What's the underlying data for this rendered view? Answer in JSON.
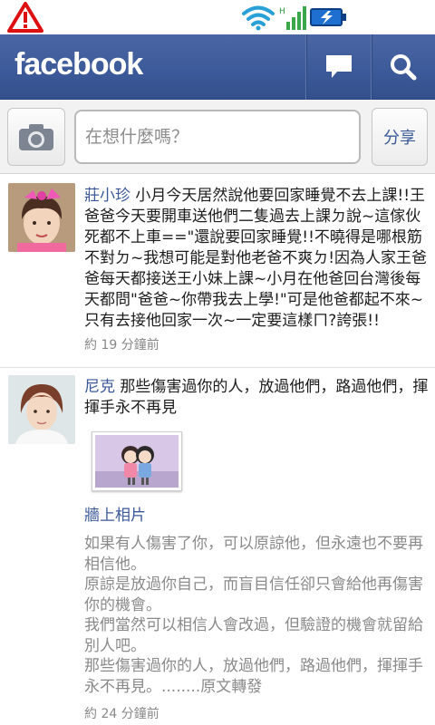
{
  "app": {
    "logo": "facebook"
  },
  "status_bar": {
    "icons": [
      "warning-icon",
      "wifi-icon",
      "signal-icon",
      "battery-charging-icon"
    ]
  },
  "header": {
    "icons": [
      "messages-icon",
      "search-icon"
    ]
  },
  "composer": {
    "placeholder": "在想什麼嗎？",
    "share_label": "分享",
    "camera_icon": "camera-icon"
  },
  "colors": {
    "brand": "#3b5998",
    "link": "#3b5998",
    "meta_text": "#888888"
  },
  "feed": [
    {
      "author": "莊小珍",
      "text": "小月今天居然說他要回家睡覺不去上課!!王爸爸今天要開車送他們二隻過去上課ㄉ說~這傢伙死都不上車==\"還說要回家睡覺!!不曉得是哪根筋不對ㄉ~我想可能是對他老爸不爽ㄉ!因為人家王爸爸每天都接送王小妹上課~小月在他爸回台灣後每天都問\"爸爸~你帶我去上學!\"可是他爸都起不來~只有去接他回家一次~一定要這樣ㄇ?誇張!!",
      "time": "約 19 分鐘前"
    },
    {
      "author": "尼克",
      "text": "那些傷害過你的人，放過他們，路過他們，揮揮手永不再見",
      "album": "牆上相片",
      "caption": "如果有人傷害了你，可以原諒他，但永遠也不要再相信他。\n原諒是放過你自己，而盲目信任卻只會給他再傷害你的機會。\n我們當然可以相信人會改過，但驗證的機會就留給別人吧。\n那些傷害過你的人，放過他們，路過他們，揮揮手永不再見。........原文轉發",
      "time": "約 24 分鐘前"
    }
  ]
}
